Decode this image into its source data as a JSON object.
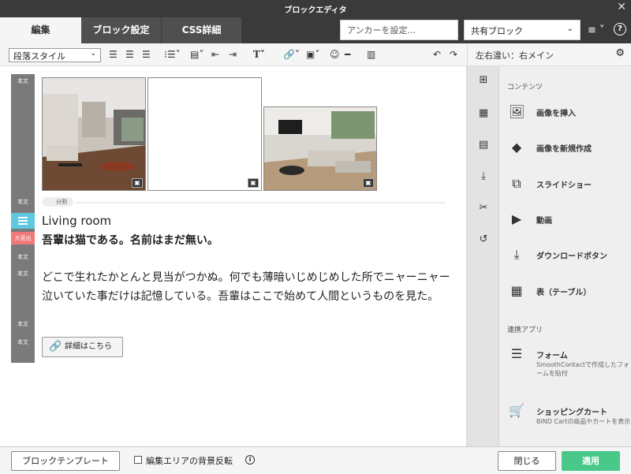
{
  "window": {
    "title": "ブロックエディタ"
  },
  "tabs": [
    {
      "label": "編集",
      "active": true
    },
    {
      "label": "ブロック設定",
      "active": false
    },
    {
      "label": "CSS詳細",
      "active": false
    }
  ],
  "anchor": {
    "placeholder": "アンカーを設定..."
  },
  "shared_block": {
    "value": "共有ブロック"
  },
  "toolbar": {
    "paragraph_style": "段落スタイル"
  },
  "right_panel": {
    "header": "左右違い：右メイン",
    "sections": [
      {
        "label": "コンテンツ",
        "items": [
          {
            "label": "画像を挿入",
            "icon": "image-icon"
          },
          {
            "label": "画像を新規作成",
            "icon": "shapes-icon"
          },
          {
            "label": "スライドショー",
            "icon": "slideshow-icon"
          },
          {
            "label": "動画",
            "icon": "video-icon"
          },
          {
            "label": "ダウンロードボタン",
            "icon": "download-icon"
          },
          {
            "label": "表（テーブル）",
            "icon": "table-icon"
          }
        ]
      },
      {
        "label": "連携アプリ",
        "items": [
          {
            "label": "フォーム",
            "sub": "SmoothContactで作成したフォームを貼付",
            "icon": "form-icon"
          },
          {
            "label": "ショッピングカート",
            "sub": "BiND Cartの商品やカートを表示",
            "icon": "cart-icon"
          }
        ]
      }
    ]
  },
  "editor": {
    "gutter_tags": [
      "本文",
      "本文",
      "大見出",
      "本文",
      "本文",
      "本文",
      "本文"
    ],
    "divider_label": "分割",
    "image_caption": "Living room",
    "heading": "吾輩は猫である。名前はまだ無い。",
    "body": "どこで生れたかとんと見当がつかぬ。何でも薄暗いじめじめした所でニャーニャー泣いていた事だけは記憶している。吾輩はここで始めて人間というものを見た。",
    "detail_button": "詳細はこちら"
  },
  "footer": {
    "template_button": "ブロックテンプレート",
    "bg_invert_label": "編集エリアの背景反転",
    "close_button": "閉じる",
    "apply_button": "適用"
  },
  "colors": {
    "apply": "#49c88a",
    "h2_tag": "#f07a7a",
    "caption_tag": "#5fc7de"
  }
}
